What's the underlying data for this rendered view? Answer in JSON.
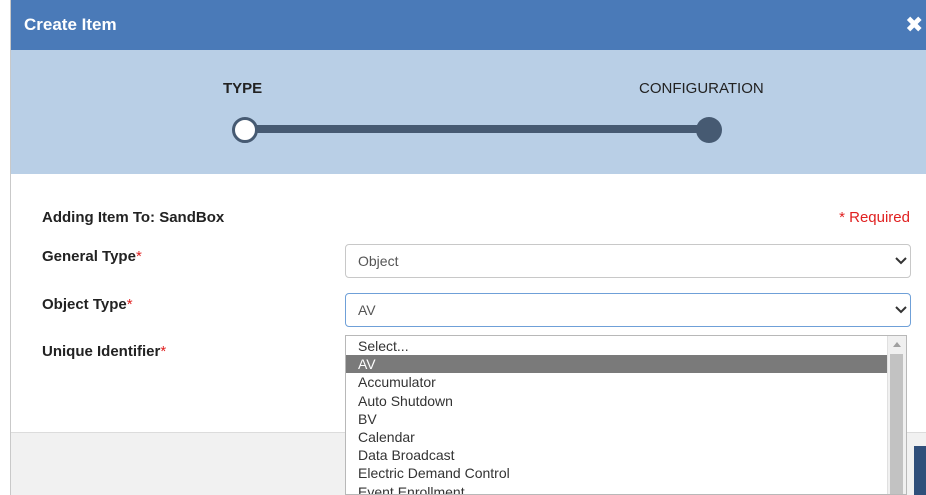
{
  "dialog": {
    "title": "Create Item",
    "close_glyph": "✖"
  },
  "stepper": {
    "steps": [
      {
        "label": "TYPE",
        "state": "current"
      },
      {
        "label": "CONFIGURATION",
        "state": "pending"
      }
    ]
  },
  "form": {
    "adding_to": "Adding Item To: SandBox",
    "required_note": "* Required",
    "asterisk": "*",
    "general_type": {
      "label": "General Type",
      "value": "Object"
    },
    "object_type": {
      "label": "Object Type",
      "value": "AV"
    },
    "unique_identifier": {
      "label": "Unique Identifier"
    }
  },
  "dropdown": {
    "options": [
      "Select...",
      "AV",
      "Accumulator",
      "Auto Shutdown",
      "BV",
      "Calendar",
      "Data Broadcast",
      "Electric Demand Control",
      "Event Enrollment"
    ],
    "selected_index": 1
  },
  "icons": {
    "close": "close-icon",
    "chevron": "chevron-down-icon",
    "scroll_up": "scroll-up-arrow-icon"
  },
  "colors": {
    "titlebar": "#4a7ab8",
    "stepper_bg": "#b9cfe6",
    "track": "#465a72",
    "required": "#e02020",
    "selected_option": "#7a7a7a"
  }
}
